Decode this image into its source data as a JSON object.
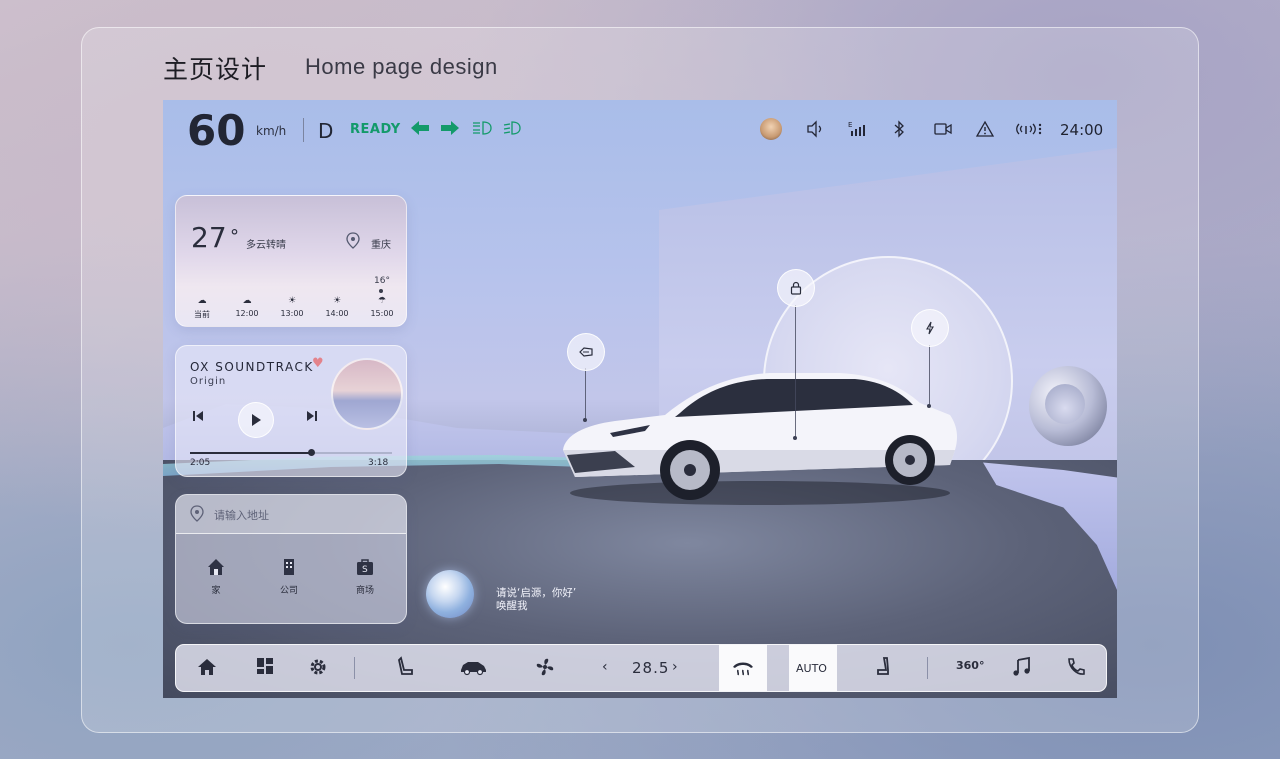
{
  "page": {
    "title": "主页设计",
    "subtitle": "Home page design"
  },
  "status_bar": {
    "speed": "60",
    "speed_unit": "km/h",
    "gear": "D",
    "ready": "READY",
    "time": "24:00",
    "left_icons": [
      "left-turn-signal-icon",
      "right-turn-signal-icon",
      "high-beam-icon",
      "low-beam-icon"
    ],
    "right_icons": [
      "avatar",
      "volume-icon",
      "signal-icon",
      "bluetooth-icon",
      "camera-icon",
      "warning-icon",
      "hotspot-icon"
    ]
  },
  "weather": {
    "temp": "27",
    "deg": "°",
    "desc": "多云转晴",
    "location": "重庆",
    "high": "16°",
    "forecast": [
      {
        "time": "当前",
        "icon": "cloudy-icon"
      },
      {
        "time": "12:00",
        "icon": "cloudy-icon"
      },
      {
        "time": "13:00",
        "icon": "sun-icon"
      },
      {
        "time": "14:00",
        "icon": "sun-icon"
      },
      {
        "time": "15:00",
        "icon": "rain-icon"
      }
    ]
  },
  "music": {
    "title": "OX SOUNDTRACK",
    "artist": "Origin",
    "current": "2:05",
    "duration": "3:18",
    "progress": 0.6
  },
  "nav": {
    "placeholder": "请输入地址",
    "destinations": [
      {
        "label": "家",
        "icon": "home-icon"
      },
      {
        "label": "公司",
        "icon": "building-icon"
      },
      {
        "label": "商场",
        "icon": "shopping-bag-icon"
      }
    ]
  },
  "voice": {
    "line1": "请说‘启源，你好’",
    "line2": "唤醒我"
  },
  "dock": {
    "temperature": "28.5",
    "auto_label": "AUTO",
    "label_360": "360°",
    "icons": [
      "home-icon",
      "apps-icon",
      "settings-icon",
      "seat-icon",
      "car-icon",
      "fan-icon",
      "defrost-icon",
      "seat-heat-icon",
      "camera-360-icon",
      "music-icon",
      "phone-icon"
    ]
  },
  "colors": {
    "ready_green": "#139a6a",
    "heart": "#e3838b"
  }
}
